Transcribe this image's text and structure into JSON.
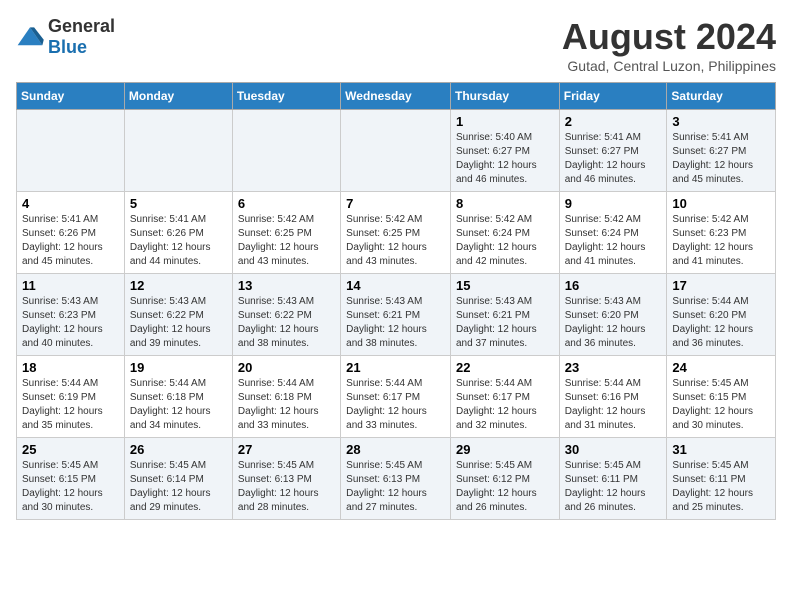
{
  "header": {
    "logo_general": "General",
    "logo_blue": "Blue",
    "title": "August 2024",
    "subtitle": "Gutad, Central Luzon, Philippines"
  },
  "days_of_week": [
    "Sunday",
    "Monday",
    "Tuesday",
    "Wednesday",
    "Thursday",
    "Friday",
    "Saturday"
  ],
  "weeks": [
    [
      {
        "day": "",
        "info": ""
      },
      {
        "day": "",
        "info": ""
      },
      {
        "day": "",
        "info": ""
      },
      {
        "day": "",
        "info": ""
      },
      {
        "day": "1",
        "info": "Sunrise: 5:40 AM\nSunset: 6:27 PM\nDaylight: 12 hours and 46 minutes."
      },
      {
        "day": "2",
        "info": "Sunrise: 5:41 AM\nSunset: 6:27 PM\nDaylight: 12 hours and 46 minutes."
      },
      {
        "day": "3",
        "info": "Sunrise: 5:41 AM\nSunset: 6:27 PM\nDaylight: 12 hours and 45 minutes."
      }
    ],
    [
      {
        "day": "4",
        "info": "Sunrise: 5:41 AM\nSunset: 6:26 PM\nDaylight: 12 hours and 45 minutes."
      },
      {
        "day": "5",
        "info": "Sunrise: 5:41 AM\nSunset: 6:26 PM\nDaylight: 12 hours and 44 minutes."
      },
      {
        "day": "6",
        "info": "Sunrise: 5:42 AM\nSunset: 6:25 PM\nDaylight: 12 hours and 43 minutes."
      },
      {
        "day": "7",
        "info": "Sunrise: 5:42 AM\nSunset: 6:25 PM\nDaylight: 12 hours and 43 minutes."
      },
      {
        "day": "8",
        "info": "Sunrise: 5:42 AM\nSunset: 6:24 PM\nDaylight: 12 hours and 42 minutes."
      },
      {
        "day": "9",
        "info": "Sunrise: 5:42 AM\nSunset: 6:24 PM\nDaylight: 12 hours and 41 minutes."
      },
      {
        "day": "10",
        "info": "Sunrise: 5:42 AM\nSunset: 6:23 PM\nDaylight: 12 hours and 41 minutes."
      }
    ],
    [
      {
        "day": "11",
        "info": "Sunrise: 5:43 AM\nSunset: 6:23 PM\nDaylight: 12 hours and 40 minutes."
      },
      {
        "day": "12",
        "info": "Sunrise: 5:43 AM\nSunset: 6:22 PM\nDaylight: 12 hours and 39 minutes."
      },
      {
        "day": "13",
        "info": "Sunrise: 5:43 AM\nSunset: 6:22 PM\nDaylight: 12 hours and 38 minutes."
      },
      {
        "day": "14",
        "info": "Sunrise: 5:43 AM\nSunset: 6:21 PM\nDaylight: 12 hours and 38 minutes."
      },
      {
        "day": "15",
        "info": "Sunrise: 5:43 AM\nSunset: 6:21 PM\nDaylight: 12 hours and 37 minutes."
      },
      {
        "day": "16",
        "info": "Sunrise: 5:43 AM\nSunset: 6:20 PM\nDaylight: 12 hours and 36 minutes."
      },
      {
        "day": "17",
        "info": "Sunrise: 5:44 AM\nSunset: 6:20 PM\nDaylight: 12 hours and 36 minutes."
      }
    ],
    [
      {
        "day": "18",
        "info": "Sunrise: 5:44 AM\nSunset: 6:19 PM\nDaylight: 12 hours and 35 minutes."
      },
      {
        "day": "19",
        "info": "Sunrise: 5:44 AM\nSunset: 6:18 PM\nDaylight: 12 hours and 34 minutes."
      },
      {
        "day": "20",
        "info": "Sunrise: 5:44 AM\nSunset: 6:18 PM\nDaylight: 12 hours and 33 minutes."
      },
      {
        "day": "21",
        "info": "Sunrise: 5:44 AM\nSunset: 6:17 PM\nDaylight: 12 hours and 33 minutes."
      },
      {
        "day": "22",
        "info": "Sunrise: 5:44 AM\nSunset: 6:17 PM\nDaylight: 12 hours and 32 minutes."
      },
      {
        "day": "23",
        "info": "Sunrise: 5:44 AM\nSunset: 6:16 PM\nDaylight: 12 hours and 31 minutes."
      },
      {
        "day": "24",
        "info": "Sunrise: 5:45 AM\nSunset: 6:15 PM\nDaylight: 12 hours and 30 minutes."
      }
    ],
    [
      {
        "day": "25",
        "info": "Sunrise: 5:45 AM\nSunset: 6:15 PM\nDaylight: 12 hours and 30 minutes."
      },
      {
        "day": "26",
        "info": "Sunrise: 5:45 AM\nSunset: 6:14 PM\nDaylight: 12 hours and 29 minutes."
      },
      {
        "day": "27",
        "info": "Sunrise: 5:45 AM\nSunset: 6:13 PM\nDaylight: 12 hours and 28 minutes."
      },
      {
        "day": "28",
        "info": "Sunrise: 5:45 AM\nSunset: 6:13 PM\nDaylight: 12 hours and 27 minutes."
      },
      {
        "day": "29",
        "info": "Sunrise: 5:45 AM\nSunset: 6:12 PM\nDaylight: 12 hours and 26 minutes."
      },
      {
        "day": "30",
        "info": "Sunrise: 5:45 AM\nSunset: 6:11 PM\nDaylight: 12 hours and 26 minutes."
      },
      {
        "day": "31",
        "info": "Sunrise: 5:45 AM\nSunset: 6:11 PM\nDaylight: 12 hours and 25 minutes."
      }
    ]
  ]
}
